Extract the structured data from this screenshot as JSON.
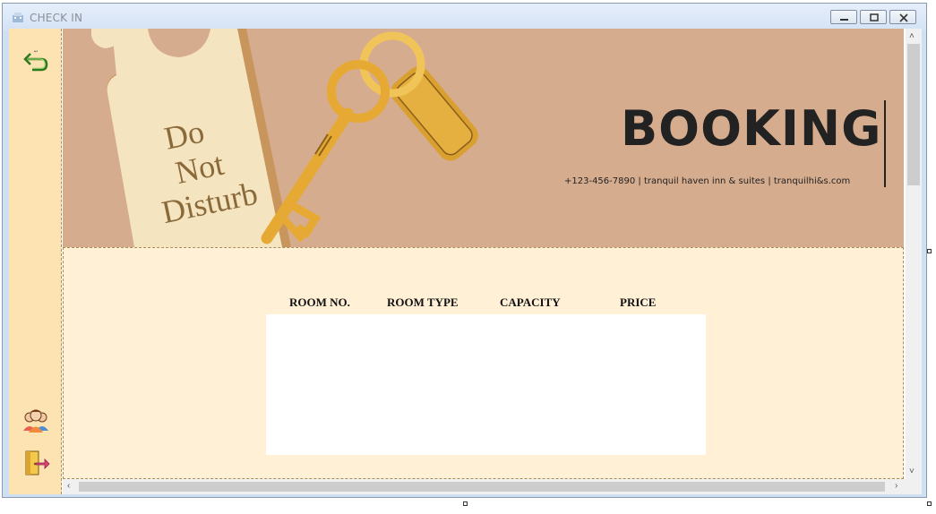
{
  "window": {
    "title": "CHECK IN"
  },
  "sidebar": {
    "icons": [
      "back-arrow-icon",
      "guests-group-icon",
      "exit-door-icon"
    ]
  },
  "banner": {
    "tag_text": [
      "Do",
      "Not",
      "Disturb"
    ],
    "title": "BOOKING",
    "contact": "+123-456-7890  |  tranquil haven inn & suites  |  tranquilhi&s.com"
  },
  "table": {
    "columns": [
      "ROOM NO.",
      "ROOM TYPE",
      "CAPACITY",
      "PRICE"
    ],
    "rows": []
  },
  "colors": {
    "sidebar_bg": "#fde3b2",
    "banner_bg": "#d6ac8e",
    "content_bg": "#fff0d6",
    "key_gold": "#e5a934"
  }
}
